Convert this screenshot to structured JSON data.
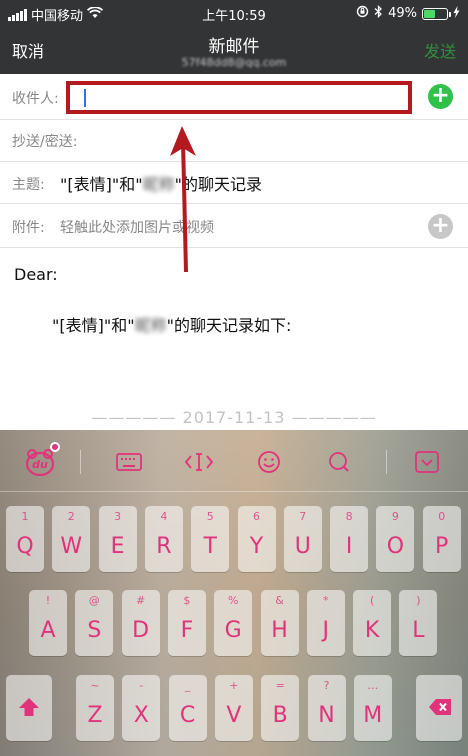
{
  "status": {
    "carrier": "中国移动",
    "time": "上午10:59",
    "battery": "49%",
    "battery_level": 0.49
  },
  "nav": {
    "cancel": "取消",
    "title": "新邮件",
    "subtitle": "57f48dd8@qq.com",
    "send": "发送"
  },
  "form": {
    "to_label": "收件人:",
    "to_value": "",
    "cc_label": "抄送/密送:",
    "subject_label": "主题:",
    "subject_pre": "\"[表情]\"和\"",
    "subject_blur": "昵称",
    "subject_post": "\"的聊天记录",
    "attach_label": "附件:",
    "attach_hint": "轻触此处添加图片或视频"
  },
  "body": {
    "greeting": "Dear:",
    "line_pre": "\"[表情]\"和\"",
    "line_blur": "昵称",
    "line_post": "\"的聊天记录如下:",
    "date_separator": "————— 2017-11-13 —————"
  },
  "colors": {
    "accent_pink": "#e0337c",
    "highlight_red": "#b3191f",
    "add_green": "#2ec24a",
    "send_green": "#2f8f3a"
  },
  "keyboard": {
    "toolbar_icons": [
      "du-logo-icon",
      "keyboard-icon",
      "cursor-move-icon",
      "emoji-icon",
      "search-icon",
      "hide-keyboard-icon"
    ],
    "row1": [
      {
        "k": "Q",
        "h": "1"
      },
      {
        "k": "W",
        "h": "2"
      },
      {
        "k": "E",
        "h": "3"
      },
      {
        "k": "R",
        "h": "4"
      },
      {
        "k": "T",
        "h": "5"
      },
      {
        "k": "Y",
        "h": "6"
      },
      {
        "k": "U",
        "h": "7"
      },
      {
        "k": "I",
        "h": "8"
      },
      {
        "k": "O",
        "h": "9"
      },
      {
        "k": "P",
        "h": "0"
      }
    ],
    "row2": [
      {
        "k": "A",
        "h": "!"
      },
      {
        "k": "S",
        "h": "@"
      },
      {
        "k": "D",
        "h": "#"
      },
      {
        "k": "F",
        "h": "$"
      },
      {
        "k": "G",
        "h": "%"
      },
      {
        "k": "H",
        "h": "&"
      },
      {
        "k": "J",
        "h": "*"
      },
      {
        "k": "K",
        "h": "("
      },
      {
        "k": "L",
        "h": ")"
      }
    ],
    "row3": [
      {
        "k": "Z",
        "h": "~"
      },
      {
        "k": "X",
        "h": "-"
      },
      {
        "k": "C",
        "h": "_"
      },
      {
        "k": "V",
        "h": "+"
      },
      {
        "k": "B",
        "h": "="
      },
      {
        "k": "N",
        "h": "?"
      },
      {
        "k": "M",
        "h": "…"
      }
    ]
  }
}
